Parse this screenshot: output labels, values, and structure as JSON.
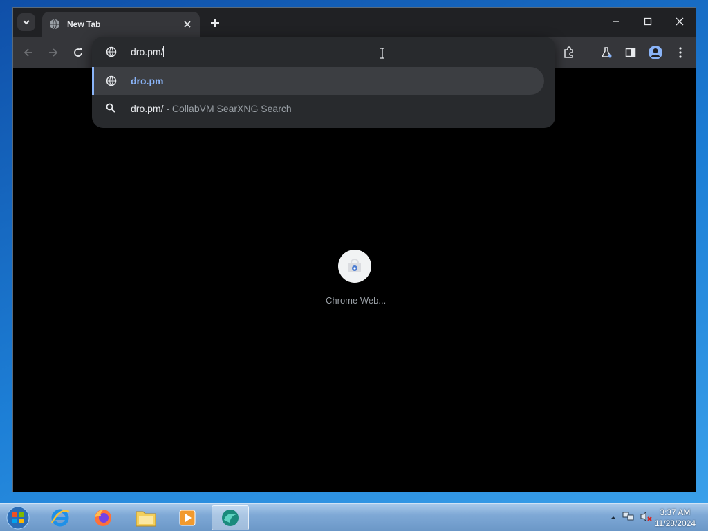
{
  "browser": {
    "tab": {
      "title": "New Tab"
    },
    "omnibox": {
      "value": "dro.pm/",
      "suggestions": [
        {
          "text": "dro.pm",
          "subtext": ""
        },
        {
          "text": "dro.pm/",
          "subtext": "- CollabVM SearXNG Search"
        }
      ]
    },
    "ntp": {
      "tile_label": "Chrome Web..."
    }
  },
  "taskbar": {
    "clock": {
      "time": "3:37 AM",
      "date": "11/28/2024"
    }
  },
  "colors": {
    "accent": "#8ab4f8",
    "tab_bg": "#35363a",
    "frame_bg": "#202124"
  }
}
